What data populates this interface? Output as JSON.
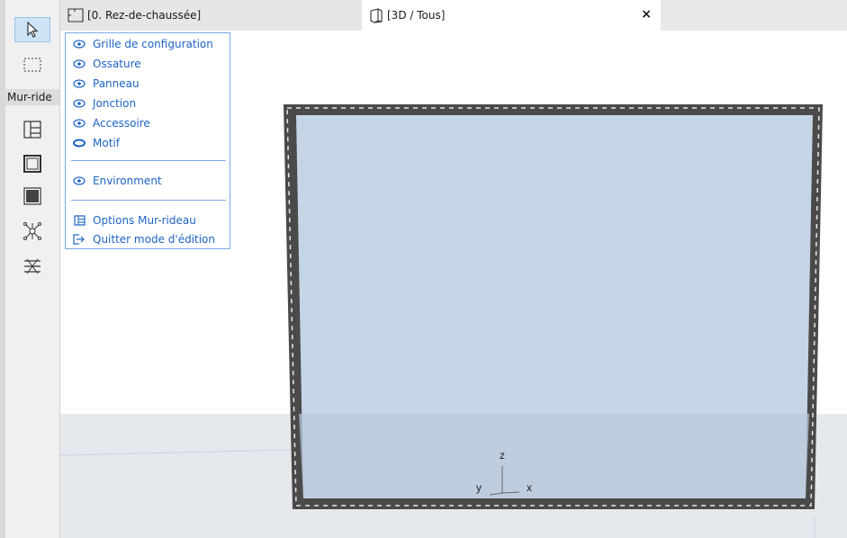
{
  "tabs": {
    "plan_label": "[0. Rez-de-chaussée]",
    "view3d_label": "[3D / Tous]",
    "close_symbol": "×"
  },
  "toolbox": {
    "mode_label": "Mur-ride",
    "tools": [
      {
        "icon": "arrow-pointer-icon",
        "selected": true
      },
      {
        "icon": "marquee-selection-icon",
        "selected": false
      },
      {
        "icon": "curtain-wall-grid-icon",
        "selected": false
      },
      {
        "icon": "frame-icon",
        "selected": false
      },
      {
        "icon": "panel-icon",
        "selected": false
      },
      {
        "icon": "junction-icon",
        "selected": false
      },
      {
        "icon": "accessory-icon",
        "selected": false
      }
    ]
  },
  "menu": {
    "items": [
      {
        "label": "Grille de configuration",
        "icon": "eye-icon"
      },
      {
        "label": "Ossature",
        "icon": "eye-icon"
      },
      {
        "label": "Panneau",
        "icon": "eye-icon"
      },
      {
        "label": "Jonction",
        "icon": "eye-icon"
      },
      {
        "label": "Accessoire",
        "icon": "eye-icon"
      },
      {
        "label": "Motif",
        "icon": "eye-closed-icon"
      },
      {
        "label": "Environment",
        "icon": "eye-icon"
      },
      {
        "label": "Options Mur-rideau",
        "icon": "grid-settings-icon"
      },
      {
        "label": "Quitter mode d'édition",
        "icon": "exit-icon"
      }
    ]
  },
  "axes": {
    "z": "z",
    "y": "y",
    "x": "x"
  },
  "colors": {
    "accent": "#1e63c6",
    "menu_border": "#7aa9e6",
    "wall_fill": "#c5d5e6",
    "frame": "#4a4a4a"
  }
}
